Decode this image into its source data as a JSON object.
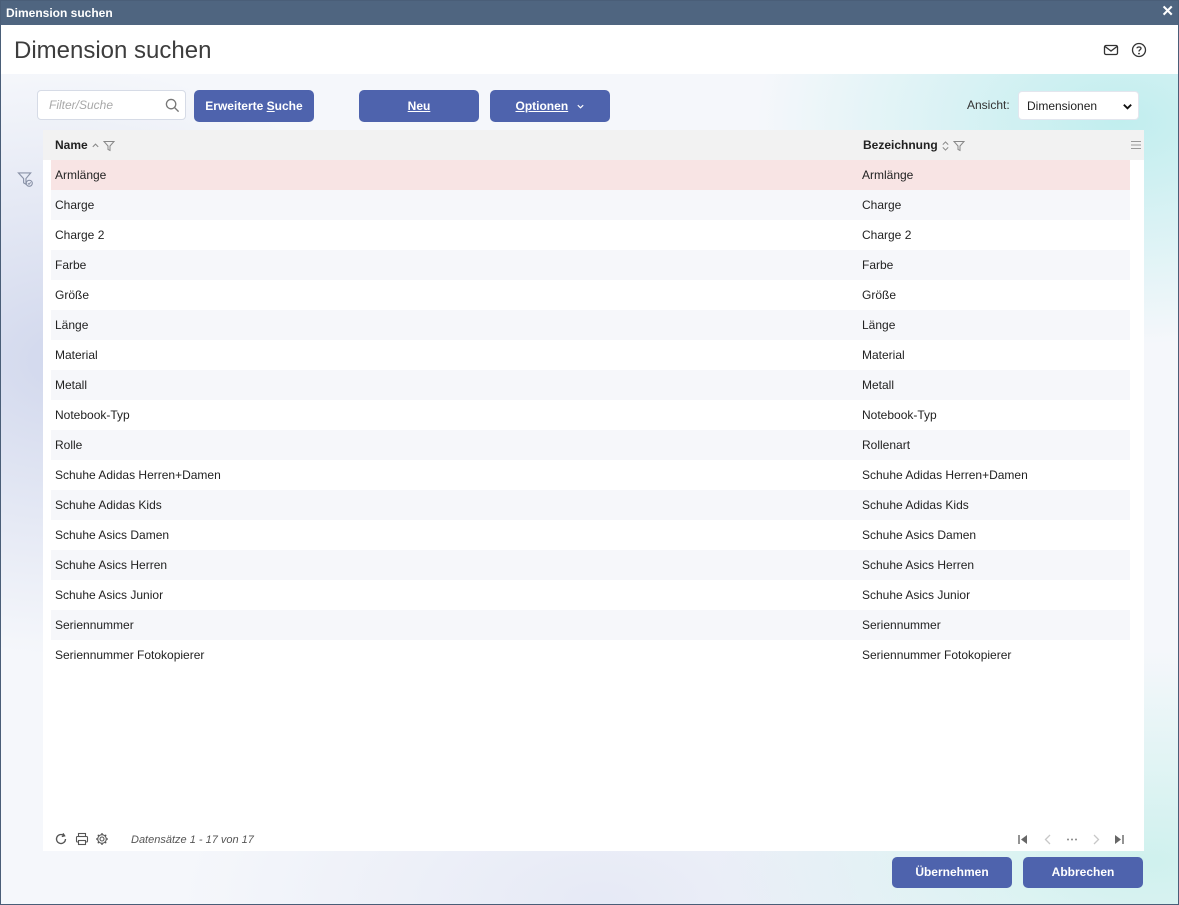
{
  "window": {
    "title": "Dimension suchen",
    "close_glyph": "✕"
  },
  "header": {
    "title": "Dimension suchen",
    "icons": [
      "mail-icon",
      "help-icon"
    ]
  },
  "toolbar": {
    "search_placeholder": "Filter/Suche",
    "advanced_search_pre": "Erweiterte ",
    "advanced_search_u": "S",
    "advanced_search_post": "uche",
    "new_label": "Neu",
    "options_label": "Optionen",
    "view_label": "Ansicht:",
    "view_value": "Dimensionen"
  },
  "grid": {
    "columns": [
      {
        "label": "Name",
        "sort": "ascending"
      },
      {
        "label": "Bezeichnung",
        "sort": "none"
      }
    ],
    "selected_row": 0,
    "rows": [
      {
        "name": "Armlänge",
        "bezeichnung": "Armlänge"
      },
      {
        "name": "Charge",
        "bezeichnung": "Charge"
      },
      {
        "name": "Charge 2",
        "bezeichnung": "Charge 2"
      },
      {
        "name": "Farbe",
        "bezeichnung": "Farbe"
      },
      {
        "name": "Größe",
        "bezeichnung": "Größe"
      },
      {
        "name": "Länge",
        "bezeichnung": "Länge"
      },
      {
        "name": "Material",
        "bezeichnung": "Material"
      },
      {
        "name": "Metall",
        "bezeichnung": "Metall"
      },
      {
        "name": "Notebook-Typ",
        "bezeichnung": "Notebook-Typ"
      },
      {
        "name": "Rolle",
        "bezeichnung": "Rollenart"
      },
      {
        "name": "Schuhe Adidas Herren+Damen",
        "bezeichnung": "Schuhe Adidas Herren+Damen"
      },
      {
        "name": "Schuhe Adidas Kids",
        "bezeichnung": "Schuhe Adidas Kids"
      },
      {
        "name": "Schuhe Asics Damen",
        "bezeichnung": "Schuhe Asics Damen"
      },
      {
        "name": "Schuhe Asics Herren",
        "bezeichnung": "Schuhe Asics Herren"
      },
      {
        "name": "Schuhe Asics Junior",
        "bezeichnung": "Schuhe Asics Junior"
      },
      {
        "name": "Seriennummer",
        "bezeichnung": "Seriennummer"
      },
      {
        "name": "Seriennummer Fotokopierer",
        "bezeichnung": "Seriennummer Fotokopierer"
      }
    ],
    "records_text": "Datensätze 1 - 17 von 17"
  },
  "actions": {
    "apply_label": "Übernehmen",
    "cancel_label": "Abbrechen"
  },
  "colors": {
    "primary_button": "#4e63ad",
    "titlebar": "#4f6580",
    "selected_row": "#f8e4e4"
  }
}
